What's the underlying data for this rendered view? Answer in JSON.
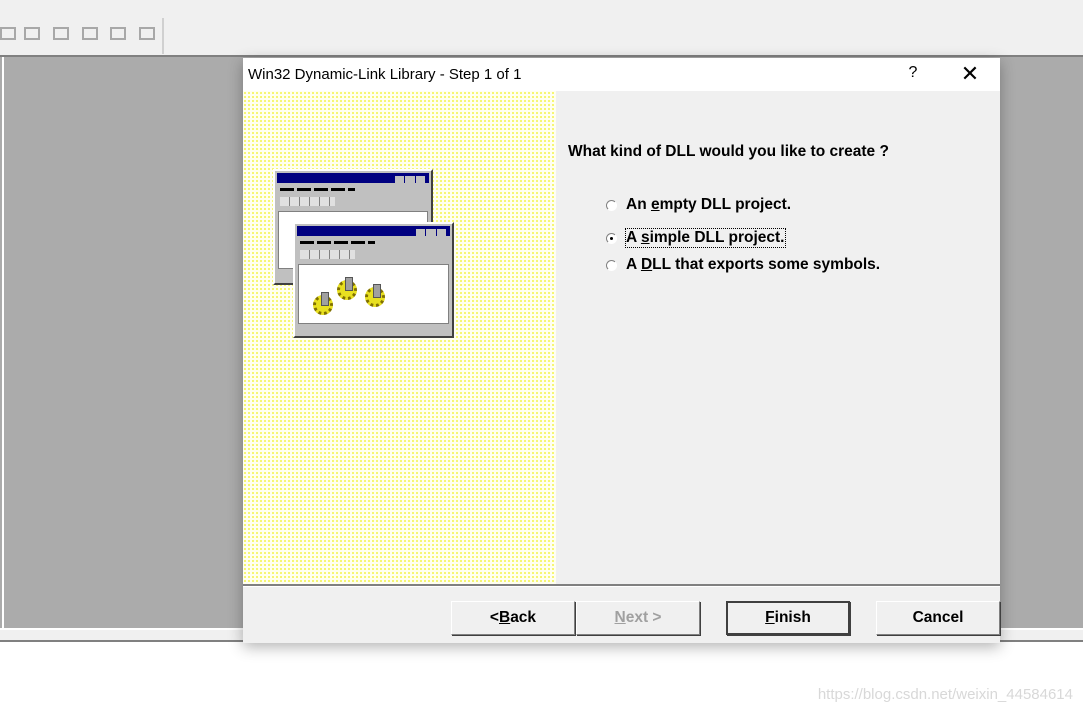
{
  "toolbar": {
    "icons": [
      "class-wizard-icon",
      "resource-icon",
      "dialog-icon",
      "list-icon",
      "hierarchy-icon",
      "browse-icon"
    ]
  },
  "dialog": {
    "title": "Win32 Dynamic-Link Library - Step 1 of 1",
    "help_label": "?",
    "close_label": "✕",
    "question": "What kind of DLL would you like to create ?",
    "options": [
      {
        "pre": "An ",
        "key": "e",
        "post": "mpty DLL project.",
        "selected": false
      },
      {
        "pre": "A ",
        "key": "s",
        "post": "imple DLL project.",
        "selected": true
      },
      {
        "pre": "A ",
        "key": "D",
        "post": "LL that exports some symbols.",
        "selected": false
      }
    ],
    "buttons": {
      "back": {
        "pre": "< ",
        "key": "B",
        "post": "ack"
      },
      "next": {
        "pre": "",
        "key": "N",
        "post": "ext >",
        "disabled": true
      },
      "finish": {
        "pre": "",
        "key": "F",
        "post": "inish"
      },
      "cancel": "Cancel"
    }
  },
  "watermark": "https://blog.csdn.net/weixin_44584614"
}
